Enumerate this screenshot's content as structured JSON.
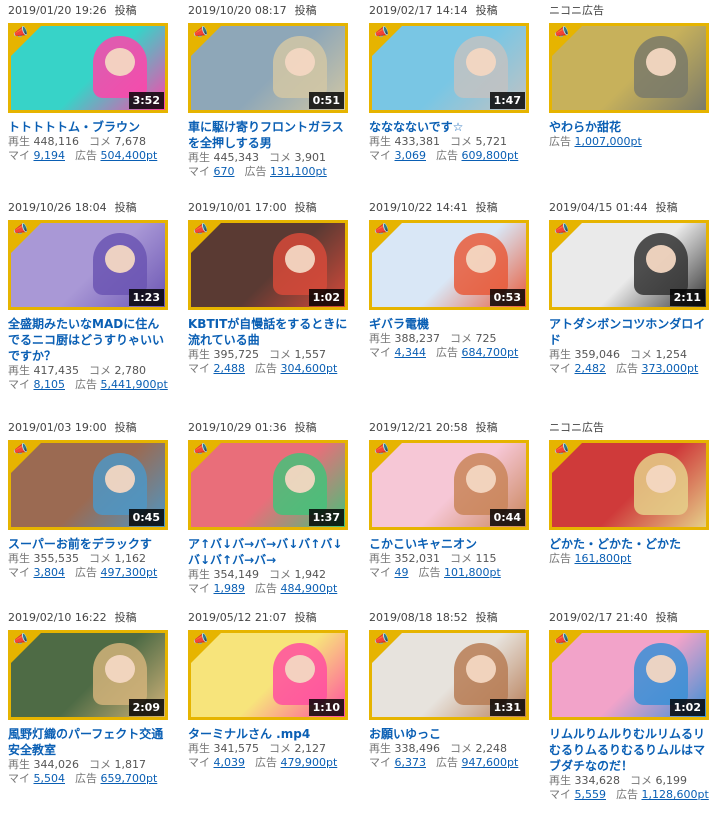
{
  "posted_label": "投稿",
  "labels": {
    "views": "再生",
    "comments": "コメ",
    "mylist": "マイ",
    "ad": "広告"
  },
  "items": [
    {
      "date": "2019/01/20 19:26",
      "dur": "3:52",
      "title": "トトトトトム・ブラウン",
      "views": "448,116",
      "comments": "7,678",
      "mylist": "9,194",
      "ad": "504,400pt",
      "bg": "#37d3c8",
      "accent": "#ff44aa"
    },
    {
      "date": "2019/10/20 08:17",
      "dur": "0:51",
      "title": "車に駆け寄りフロントガラスを全押しする男",
      "views": "445,343",
      "comments": "3,901",
      "mylist": "670",
      "ad": "131,100pt",
      "bg": "#8ea7b8",
      "accent": "#d2c7a4"
    },
    {
      "date": "2019/02/17 14:14",
      "dur": "1:47",
      "title": "なななないです☆",
      "views": "433,381",
      "comments": "5,721",
      "mylist": "3,069",
      "ad": "609,800pt",
      "bg": "#79c6e4",
      "accent": "#c2c2c2"
    },
    {
      "date": "ニコニ広告",
      "dur": "",
      "title": "やわらか甜花",
      "views": "",
      "comments": "",
      "mylist": "",
      "ad": "1,007,000pt",
      "bg": "#c7b15b",
      "accent": "#7a7a6a"
    },
    {
      "date": "2019/10/26 18:04",
      "dur": "1:23",
      "title": "全盛期みたいなMADに住んでるニコ厨はどうすりゃいいですか？",
      "views": "417,435",
      "comments": "2,780",
      "mylist": "8,105",
      "ad": "5,441,900pt",
      "bg": "#a998d6",
      "accent": "#6b55b3"
    },
    {
      "date": "2019/10/01 17:00",
      "dur": "1:02",
      "title": "KBTITが自慢話をするときに流れている曲",
      "views": "395,725",
      "comments": "1,557",
      "mylist": "2,488",
      "ad": "304,600pt",
      "bg": "#5a3a33",
      "accent": "#d64a3a"
    },
    {
      "date": "2019/10/22 14:41",
      "dur": "0:53",
      "title": "ギバラ電機",
      "views": "388,237",
      "comments": "725",
      "mylist": "4,344",
      "ad": "684,700pt",
      "bg": "#d9e7f6",
      "accent": "#e85a3a"
    },
    {
      "date": "2019/04/15 01:44",
      "dur": "2:11",
      "title": "アトダシボンコツホンダロイド",
      "views": "359,046",
      "comments": "1,254",
      "mylist": "2,482",
      "ad": "373,000pt",
      "bg": "#eaeaea",
      "accent": "#333333"
    },
    {
      "date": "2019/01/03 19:00",
      "dur": "0:45",
      "title": "スーパーお前をデラックす",
      "views": "355,535",
      "comments": "1,162",
      "mylist": "3,804",
      "ad": "497,300pt",
      "bg": "#9b6a52",
      "accent": "#4d97c5"
    },
    {
      "date": "2019/10/29 01:36",
      "dur": "1:37",
      "title": "ア↑バ↓バ→バ→バ↓バ↑バ↓バ↓バ↑バ→バ→",
      "views": "354,149",
      "comments": "1,942",
      "mylist": "1,989",
      "ad": "484,900pt",
      "bg": "#e96e7a",
      "accent": "#44c27a"
    },
    {
      "date": "2019/12/21 20:58",
      "dur": "0:44",
      "title": "こかこいキャニオン",
      "views": "352,031",
      "comments": "115",
      "mylist": "49",
      "ad": "101,800pt",
      "bg": "#f6c7d6",
      "accent": "#c98559"
    },
    {
      "date": "ニコニ広告",
      "dur": "",
      "title": "どかた・どかた・どかた",
      "views": "",
      "comments": "",
      "mylist": "",
      "ad": "161,800pt",
      "bg": "#cf3a3a",
      "accent": "#e5d08a"
    },
    {
      "date": "2019/02/10 16:22",
      "dur": "2:09",
      "title": "風野灯織のパーフェクト交通安全教室",
      "views": "344,026",
      "comments": "1,817",
      "mylist": "5,504",
      "ad": "659,700pt",
      "bg": "#4e6b45",
      "accent": "#d2b37a"
    },
    {
      "date": "2019/05/12 21:07",
      "dur": "1:10",
      "title": "ターミナルさん .mp4",
      "views": "341,575",
      "comments": "2,127",
      "mylist": "4,039",
      "ad": "479,900pt",
      "bg": "#f7e47b",
      "accent": "#ff4fa0"
    },
    {
      "date": "2019/08/18 18:52",
      "dur": "1:31",
      "title": "お願いゆっこ",
      "views": "338,496",
      "comments": "2,248",
      "mylist": "6,373",
      "ad": "947,600pt",
      "bg": "#e7e3dd",
      "accent": "#b77c55"
    },
    {
      "date": "2019/02/17 21:40",
      "dur": "1:02",
      "title": "リムルりムルりむルリムるリむるりムるりむるりムルはマブダチなのだ！",
      "views": "334,628",
      "comments": "6,199",
      "mylist": "5,559",
      "ad": "1,128,600pt",
      "bg": "#f2a3c9",
      "accent": "#3a8fd6"
    }
  ]
}
